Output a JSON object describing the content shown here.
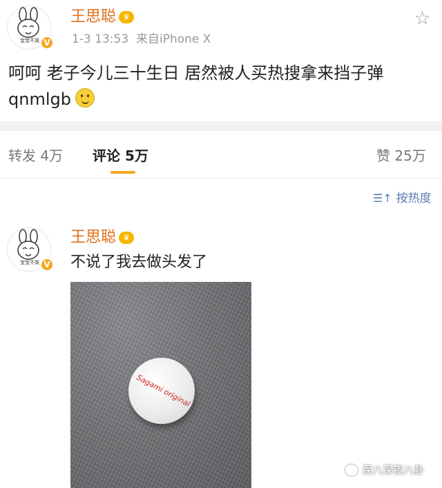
{
  "post": {
    "username": "王思聪",
    "crown_badge": "vip",
    "avatar_caption": "宝宝不哭",
    "time": "1-3 13:53",
    "source": "来自iPhone X",
    "text_line1": "呵呵 老子今儿三十生日 居然被人买热搜拿来挡子弹",
    "text_line2": "qnmlgb",
    "emoji": "smile-emoji"
  },
  "tabs": {
    "repost": "转发 4万",
    "comment": "评论 5万",
    "like": "赞 25万"
  },
  "sort": {
    "icon": "sort-icon",
    "label": "按热度"
  },
  "comment": {
    "username": "王思聪",
    "avatar_caption": "宝宝不哭",
    "text": "不说了我去做头发了",
    "photo_text": "Sagami original"
  },
  "watermark": {
    "text": "深八深夜八卦",
    "icon": "wechat-icon"
  },
  "colors": {
    "username": "#e0701a",
    "accent": "#f5a623",
    "link": "#5b7fb6"
  }
}
